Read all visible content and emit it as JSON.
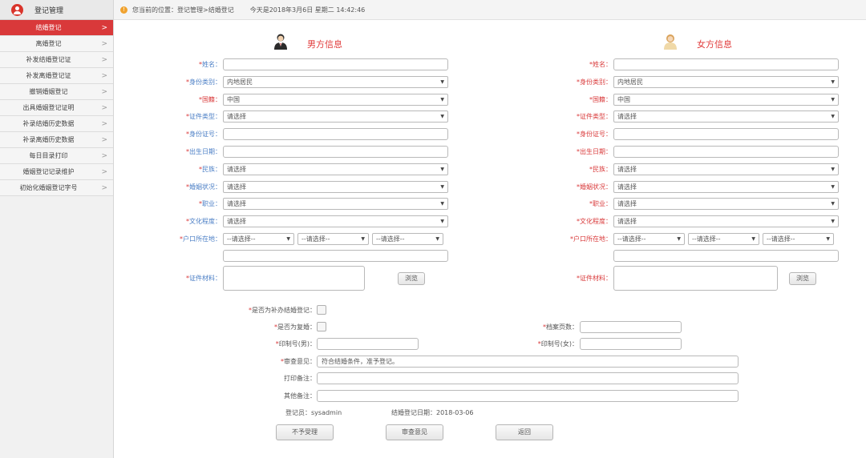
{
  "sidebar": {
    "title": "登记管理",
    "items": [
      {
        "label": "结婚登记",
        "active": true
      },
      {
        "label": "离婚登记",
        "active": false
      },
      {
        "label": "补发结婚登记证",
        "active": false
      },
      {
        "label": "补发离婚登记证",
        "active": false
      },
      {
        "label": "撤销婚姻登记",
        "active": false
      },
      {
        "label": "出具婚姻登记证明",
        "active": false
      },
      {
        "label": "补录结婚历史数据",
        "active": false
      },
      {
        "label": "补录离婚历史数据",
        "active": false
      },
      {
        "label": "每日目录打印",
        "active": false
      },
      {
        "label": "婚姻登记记录维护",
        "active": false
      },
      {
        "label": "初始化婚姻登记字号",
        "active": false
      }
    ]
  },
  "topbar": {
    "breadcrumb": "您当前的位置：登记管理>结婚登记",
    "datetime": "今天是2018年3月6日 星期二 14:42:46"
  },
  "male": {
    "title": "男方信息",
    "labels": {
      "name": "姓名：",
      "id_category": "身份类别：",
      "nationality": "国籍：",
      "id_type": "证件类型：",
      "id_number": "身份证号：",
      "birthdate": "出生日期：",
      "ethnicity": "民族：",
      "marital_status": "婚姻状况：",
      "occupation": "职业：",
      "education": "文化程度：",
      "household": "户口所在地：",
      "materials": "证件材料："
    },
    "values": {
      "name": "",
      "id_category": "内地居民",
      "nationality": "中国",
      "id_type": "请选择",
      "id_number": "",
      "birthdate": "",
      "ethnicity": "请选择",
      "marital_status": "请选择",
      "occupation": "请选择",
      "education": "请选择",
      "household_1": "--请选择--",
      "household_2": "--请选择--",
      "household_3": "--请选择--",
      "household_detail": ""
    },
    "choose_button": "浏览"
  },
  "female": {
    "title": "女方信息",
    "labels": {
      "name": "姓名：",
      "id_category": "身份类别：",
      "nationality": "国籍：",
      "id_type": "证件类型：",
      "id_number": "身份证号：",
      "birthdate": "出生日期：",
      "ethnicity": "民族：",
      "marital_status": "婚姻状况：",
      "occupation": "职业：",
      "education": "文化程度：",
      "household": "户口所在地：",
      "materials": "证件材料："
    },
    "values": {
      "name": "",
      "id_category": "内地居民",
      "nationality": "中国",
      "id_type": "请选择",
      "id_number": "",
      "birthdate": "",
      "ethnicity": "请选择",
      "marital_status": "请选择",
      "occupation": "请选择",
      "education": "请选择",
      "household_1": "--请选择--",
      "household_2": "--请选择--",
      "household_3": "--请选择--",
      "household_detail": ""
    },
    "choose_button": "浏览"
  },
  "common": {
    "supplement_label": "是否为补办结婚登记：",
    "remarried_label": "是否为复婚：",
    "archive_pages_label": "档案页数：",
    "archive_pages_value": "",
    "print_no_male_label": "印制号(男)：",
    "print_no_male_value": "",
    "print_no_female_label": "印制号(女)：",
    "print_no_female_value": "",
    "review_label": "审查意见：",
    "review_value": "符合结婚条件，准予登记。",
    "print_note_label": "打印备注：",
    "print_note_value": "",
    "other_note_label": "其他备注：",
    "other_note_value": "",
    "registrar": "登记员：sysadmin",
    "reg_date": "结婚登记日期：2018-03-06"
  },
  "buttons": {
    "reject": "不予受理",
    "review": "审查意见",
    "back": "返回"
  },
  "colors": {
    "accent_red": "#d9393a",
    "label_blue": "#4a7ec5"
  }
}
